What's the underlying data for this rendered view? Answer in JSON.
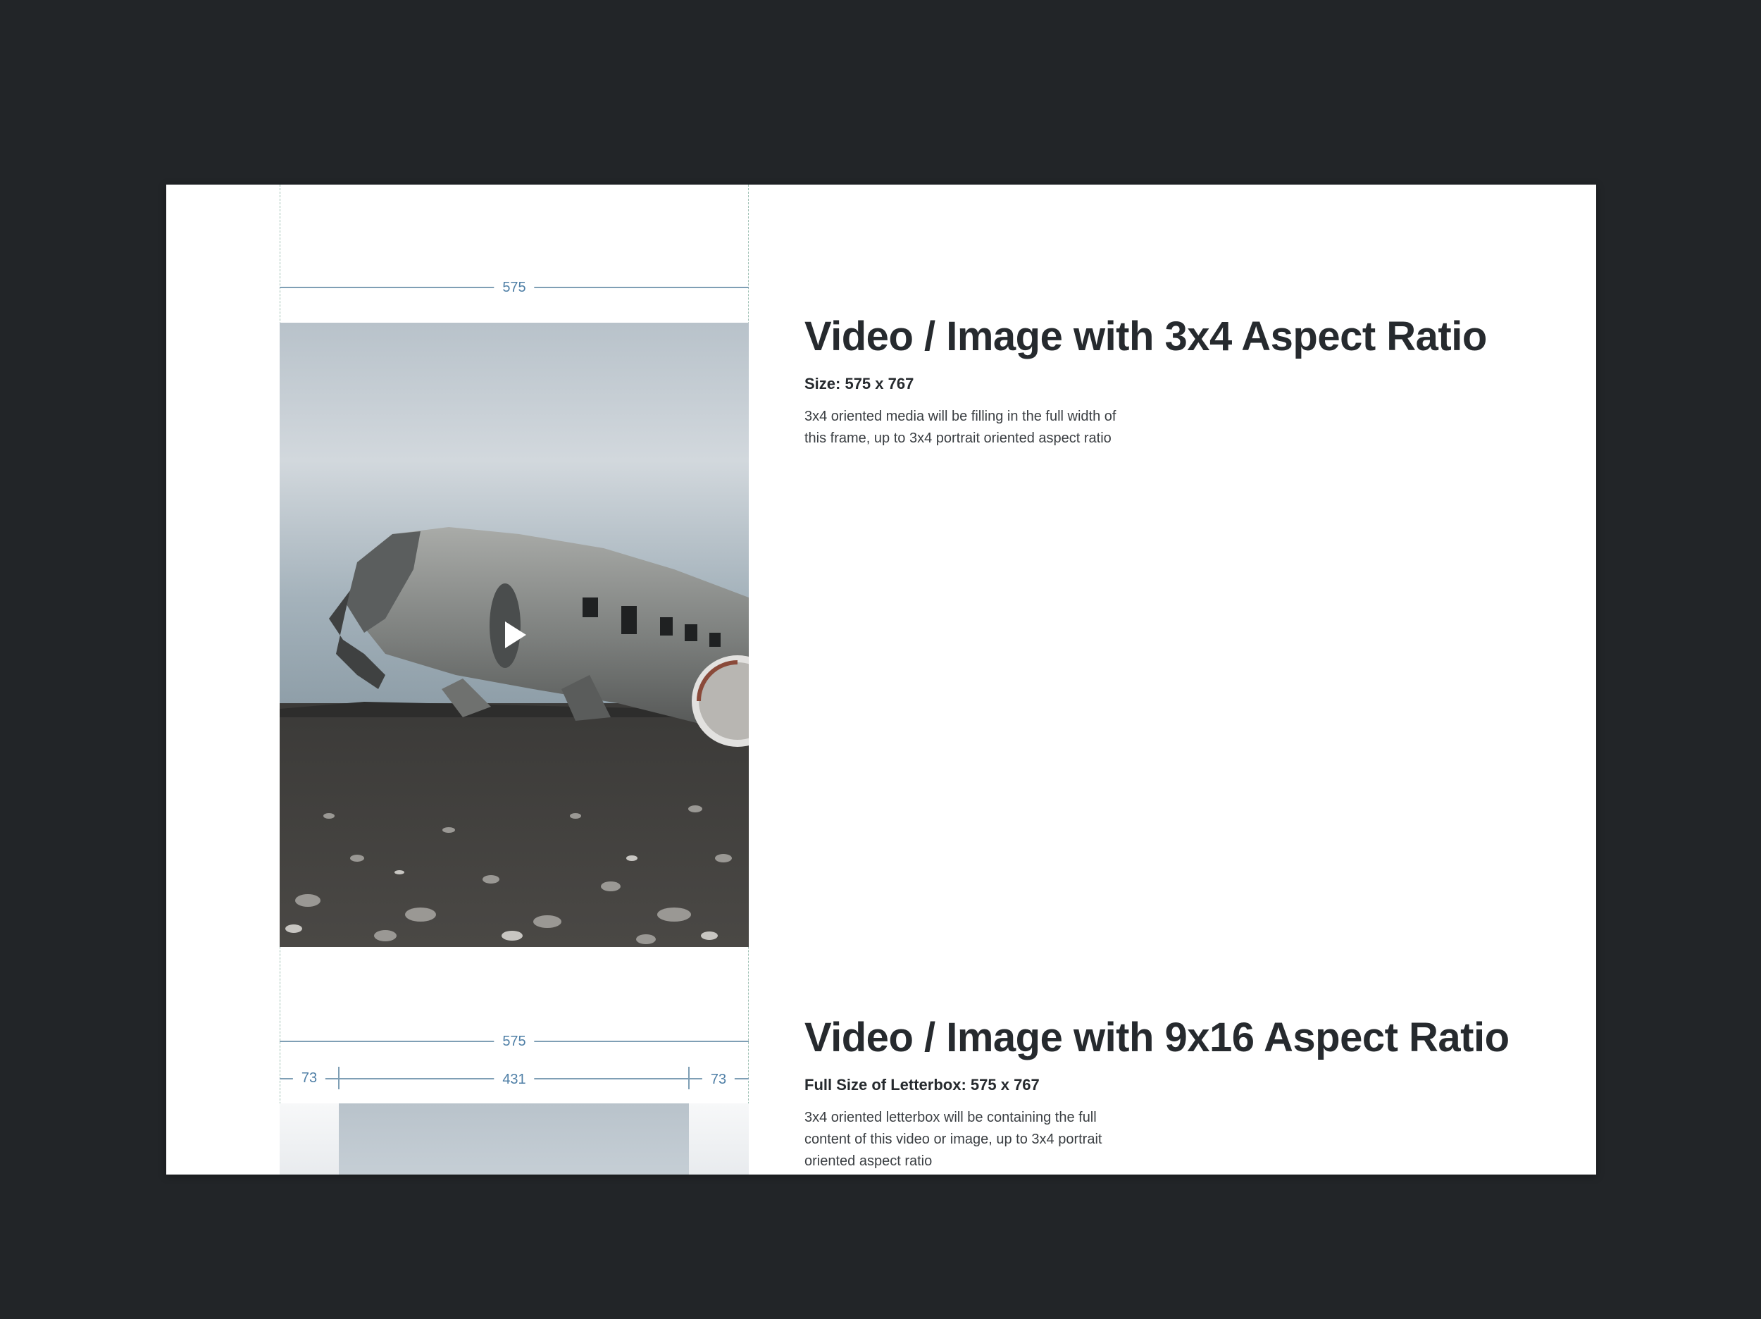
{
  "colors": {
    "backdrop": "#222528",
    "card": "#ffffff",
    "dimension": "#7f9fb5",
    "dimension_label": "#4f7fa6",
    "heading": "#262a2e"
  },
  "dimensions": {
    "frame_width": "575",
    "frame_width_2": "575",
    "side_margin_left": "73",
    "media_width": "431",
    "side_margin_right": "73"
  },
  "media": {
    "play_icon": "play-icon",
    "subject": "airplane-wreck-photo"
  },
  "sections": [
    {
      "title": "Video / Image with 3x4 Aspect Ratio",
      "size": "Size: 575 x 767",
      "description": "3x4 oriented media will be filling in the full width of this frame, up to 3x4 portrait oriented aspect ratio"
    },
    {
      "title": "Video / Image with 9x16 Aspect Ratio",
      "size": "Full Size of Letterbox: 575 x 767",
      "description": "3x4 oriented letterbox will be containing the full content of this video or image, up to 3x4 portrait oriented aspect ratio"
    }
  ]
}
